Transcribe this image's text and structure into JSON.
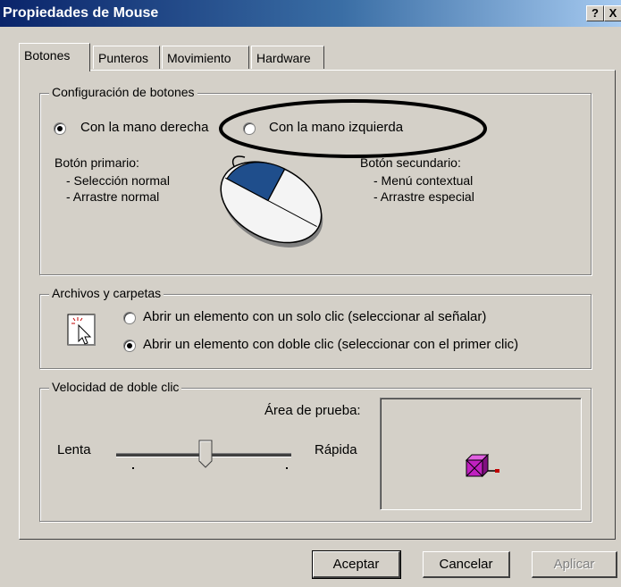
{
  "window": {
    "title": "Propiedades de Mouse",
    "help_label": "?",
    "close_label": "X"
  },
  "tabs": [
    {
      "label": "Botones",
      "active": true
    },
    {
      "label": "Punteros",
      "active": false
    },
    {
      "label": "Movimiento",
      "active": false
    },
    {
      "label": "Hardware",
      "active": false
    }
  ],
  "buttons_config": {
    "legend": "Configuración de botones",
    "right_hand_label": "Con la mano derecha",
    "left_hand_label": "Con la mano izquierda",
    "selected": "right",
    "primary_title": "Botón primario:",
    "primary_items": [
      "- Selección normal",
      "- Arrastre normal"
    ],
    "secondary_title": "Botón secundario:",
    "secondary_items": [
      "- Menú contextual",
      "- Arrastre especial"
    ]
  },
  "files_folders": {
    "legend": "Archivos y carpetas",
    "single_click_label": "Abrir un elemento con un solo clic (seleccionar al señalar)",
    "double_click_label": "Abrir un elemento con doble clic (seleccionar con el primer clic)",
    "selected": "double"
  },
  "double_click_speed": {
    "legend": "Velocidad de doble clic",
    "test_area_label": "Área de prueba:",
    "slow_label": "Lenta",
    "fast_label": "Rápida",
    "slider_value": 0.5
  },
  "footer": {
    "ok_label": "Aceptar",
    "cancel_label": "Cancelar",
    "apply_label": "Aplicar"
  },
  "colors": {
    "dialog_bg": "#d4d0c8",
    "mouse_button": "#1f4e8c",
    "test_box": "#c020c0"
  }
}
